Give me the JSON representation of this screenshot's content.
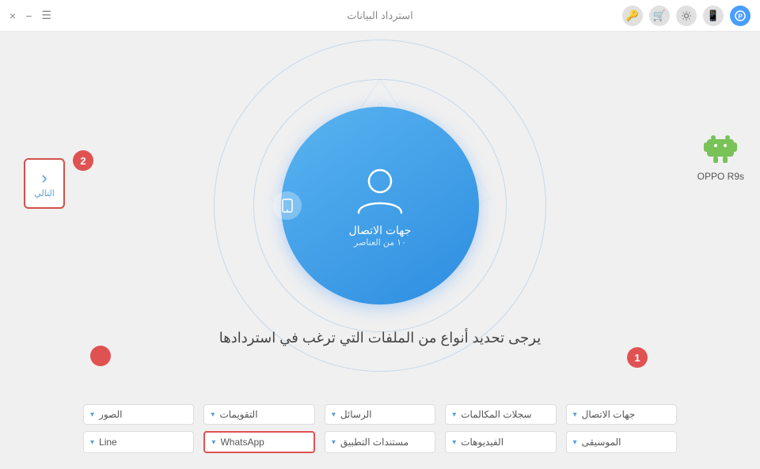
{
  "titlebar": {
    "title": "استرداد البيانات",
    "controls": {
      "menu": "☰",
      "minimize": "−",
      "close": "×"
    }
  },
  "back_button": {
    "label": "التالي",
    "chevron": "‹"
  },
  "step_badges": {
    "badge1": "1",
    "badge2": "2"
  },
  "device": {
    "name": "OPPO R9s"
  },
  "center_circle": {
    "label": "جهات الاتصال",
    "sublabel": "١٠ من العناصر"
  },
  "main_title": "يرجى تحديد أنواع من الملفات التي ترغب في استردادها",
  "file_types": [
    {
      "id": "contacts",
      "label": "جهات الاتصال",
      "highlighted": false
    },
    {
      "id": "call_logs",
      "label": "سجلات المكالمات",
      "highlighted": false
    },
    {
      "id": "messages",
      "label": "الرسائل",
      "highlighted": false
    },
    {
      "id": "calendars",
      "label": "التقويمات",
      "highlighted": false
    },
    {
      "id": "photos",
      "label": "الصور",
      "highlighted": false
    },
    {
      "id": "music",
      "label": "الموسيقى",
      "highlighted": false
    },
    {
      "id": "videos",
      "label": "الفيديوهات",
      "highlighted": false
    },
    {
      "id": "app_docs",
      "label": "مستندات التطبيق",
      "highlighted": false
    },
    {
      "id": "whatsapp",
      "label": "WhatsApp",
      "highlighted": true
    },
    {
      "id": "line",
      "label": "Line",
      "highlighted": false
    }
  ]
}
